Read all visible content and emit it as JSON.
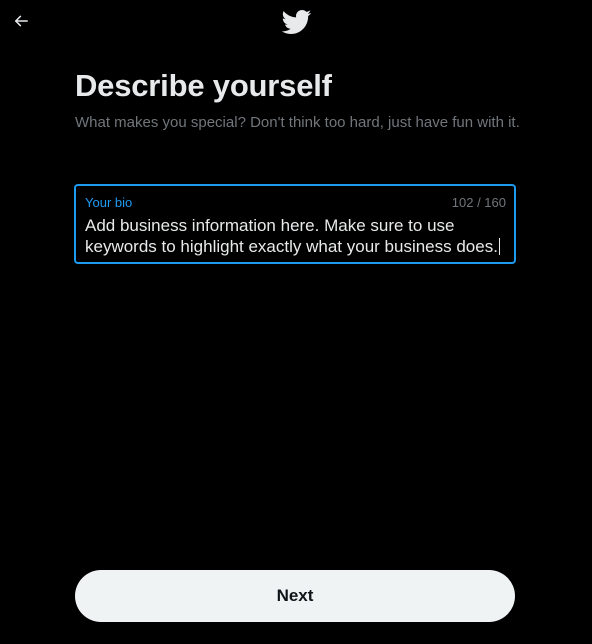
{
  "header": {
    "back_icon": "arrow-left-icon",
    "logo_icon": "twitter-bird-icon",
    "brand_color": "#1d9bf0"
  },
  "main": {
    "title": "Describe yourself",
    "subtitle": "What makes you special? Don't think too hard, just have fun with it."
  },
  "bio": {
    "label": "Your bio",
    "counter": "102 / 160",
    "value": "Add business information here. Make sure to use keywords to highlight exactly what your business does."
  },
  "footer": {
    "next_label": "Next"
  }
}
